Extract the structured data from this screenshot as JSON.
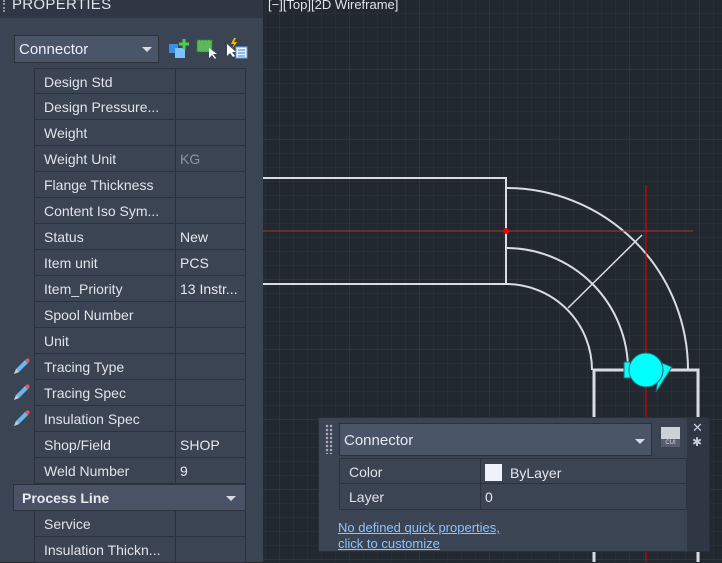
{
  "panel": {
    "title": "PROPERTIES",
    "object_type": "Connector",
    "toolbar": [
      "add-selection-icon",
      "select-objects-icon",
      "quick-select-icon"
    ]
  },
  "rows": [
    {
      "label": "Design Std",
      "value": ""
    },
    {
      "label": "Design  Pressure...",
      "value": ""
    },
    {
      "label": "Weight",
      "value": ""
    },
    {
      "label": "Weight Unit",
      "value": "KG",
      "dim": true
    },
    {
      "label": "Flange Thickness",
      "value": ""
    },
    {
      "label": "Content Iso Sym...",
      "value": ""
    },
    {
      "label": "Status",
      "value": "New"
    },
    {
      "label": "Item unit",
      "value": "PCS"
    },
    {
      "label": "Item_Priority",
      "value": "13 Instr..."
    },
    {
      "label": "Spool Number",
      "value": ""
    },
    {
      "label": "Unit",
      "value": ""
    },
    {
      "label": "Tracing Type",
      "value": "",
      "pencil": true
    },
    {
      "label": "Tracing Spec",
      "value": "",
      "pencil": true
    },
    {
      "label": "Insulation Spec",
      "value": "",
      "pencil": true
    },
    {
      "label": "Shop/Field",
      "value": "SHOP"
    },
    {
      "label": "Weld Number",
      "value": "9"
    }
  ],
  "category": {
    "label": "Process Line",
    "rows": [
      {
        "label": "Service",
        "value": ""
      },
      {
        "label": "Insulation Thickn...",
        "value": ""
      }
    ]
  },
  "viewport": {
    "label": "[−][Top][2D Wireframe]"
  },
  "quick_properties": {
    "object_type": "Connector",
    "cui_label": "CUI",
    "rows": [
      {
        "label": "Color",
        "value": "ByLayer"
      },
      {
        "label": "Layer",
        "value": "0"
      }
    ],
    "link_line1": "No defined quick properties,",
    "link_line2": "click to customize"
  }
}
